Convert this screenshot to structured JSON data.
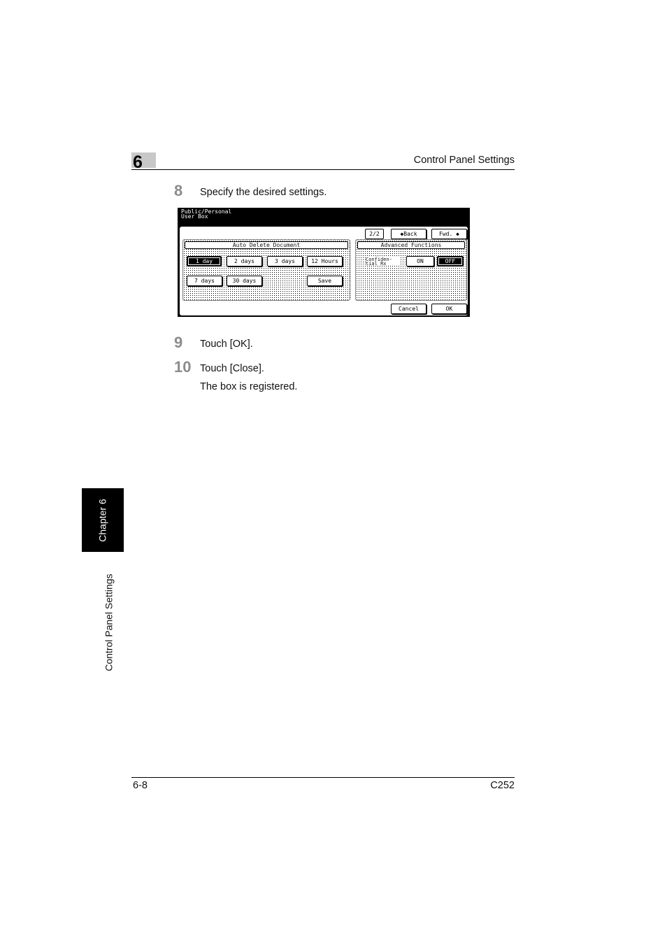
{
  "header": {
    "chapter_number": "6",
    "title": "Control Panel Settings"
  },
  "steps": [
    {
      "number": "8",
      "text": "Specify the desired settings."
    },
    {
      "number": "9",
      "text": "Touch [OK]."
    },
    {
      "number": "10",
      "text": "Touch [Close]."
    }
  ],
  "result_text": "The box is registered.",
  "screen": {
    "title": "Public/Personal\nUser Box",
    "page_indicator": "2/2",
    "back_label": "◆Back",
    "fwd_label": "Fwd. ◆",
    "auto_delete": {
      "heading": "Auto Delete Document",
      "options": [
        "1 day",
        "2 days",
        "3 days",
        "12 Hours",
        "7 days",
        "30 days"
      ],
      "selected": "1 day",
      "save_label": "Save"
    },
    "advanced": {
      "heading": "Advanced Functions",
      "confidential_label": "Confiden-\ntial Rx",
      "on_label": "ON",
      "off_label": "OFF",
      "selected": "OFF"
    },
    "cancel_label": "Cancel",
    "ok_label": "OK"
  },
  "side_tab": {
    "chapter": "Chapter 6",
    "section": "Control Panel Settings"
  },
  "footer": {
    "page": "6-8",
    "model": "C252"
  },
  "colors": {
    "step_number": "#8c8c8c",
    "chapter_box": "#c8c8c8",
    "tab_background": "#000000"
  }
}
